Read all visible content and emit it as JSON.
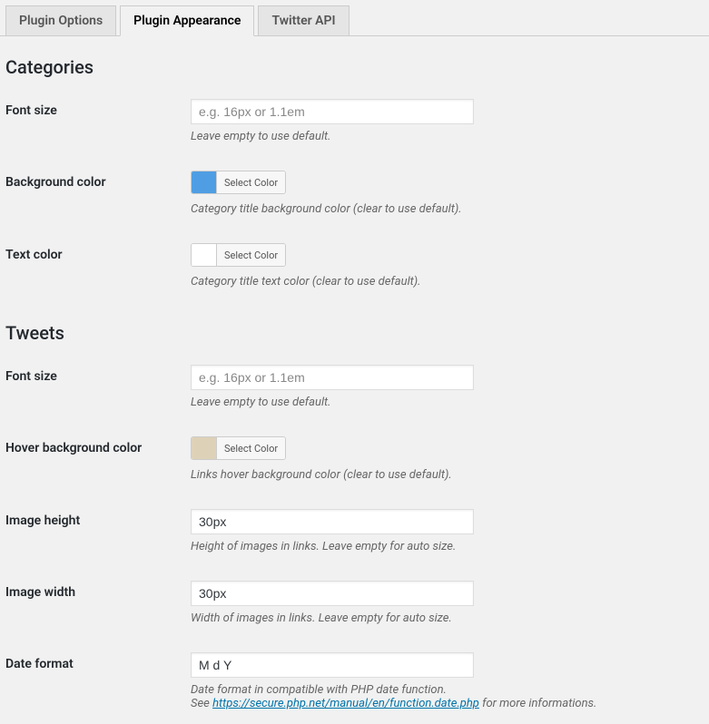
{
  "tabs": {
    "options": "Plugin Options",
    "appearance": "Plugin Appearance",
    "twitter": "Twitter API"
  },
  "select_color_label": "Select Color",
  "categories": {
    "heading": "Categories",
    "font_size": {
      "label": "Font size",
      "placeholder": "e.g. 16px or 1.1em",
      "value": "",
      "desc": "Leave empty to use default."
    },
    "bg_color": {
      "label": "Background color",
      "swatch": "#4f9ee3",
      "desc": "Category title background color (clear to use default)."
    },
    "text_color": {
      "label": "Text color",
      "swatch": "#ffffff",
      "desc": "Category title text color (clear to use default)."
    }
  },
  "tweets": {
    "heading": "Tweets",
    "font_size": {
      "label": "Font size",
      "placeholder": "e.g. 16px or 1.1em",
      "value": "",
      "desc": "Leave empty to use default."
    },
    "hover_bg": {
      "label": "Hover background color",
      "swatch": "#ddd1b8",
      "desc": "Links hover background color (clear to use default)."
    },
    "img_height": {
      "label": "Image height",
      "value": "30px",
      "desc": "Height of images in links. Leave empty for auto size."
    },
    "img_width": {
      "label": "Image width",
      "value": "30px",
      "desc": "Width of images in links. Leave empty for auto size."
    },
    "date_format": {
      "label": "Date format",
      "value": "M d Y",
      "desc_prefix": "Date format in compatible with PHP date function.",
      "desc_see": "See ",
      "link_text": "https://secure.php.net/manual/en/function.date.php",
      "desc_suffix": " for more informations."
    }
  }
}
